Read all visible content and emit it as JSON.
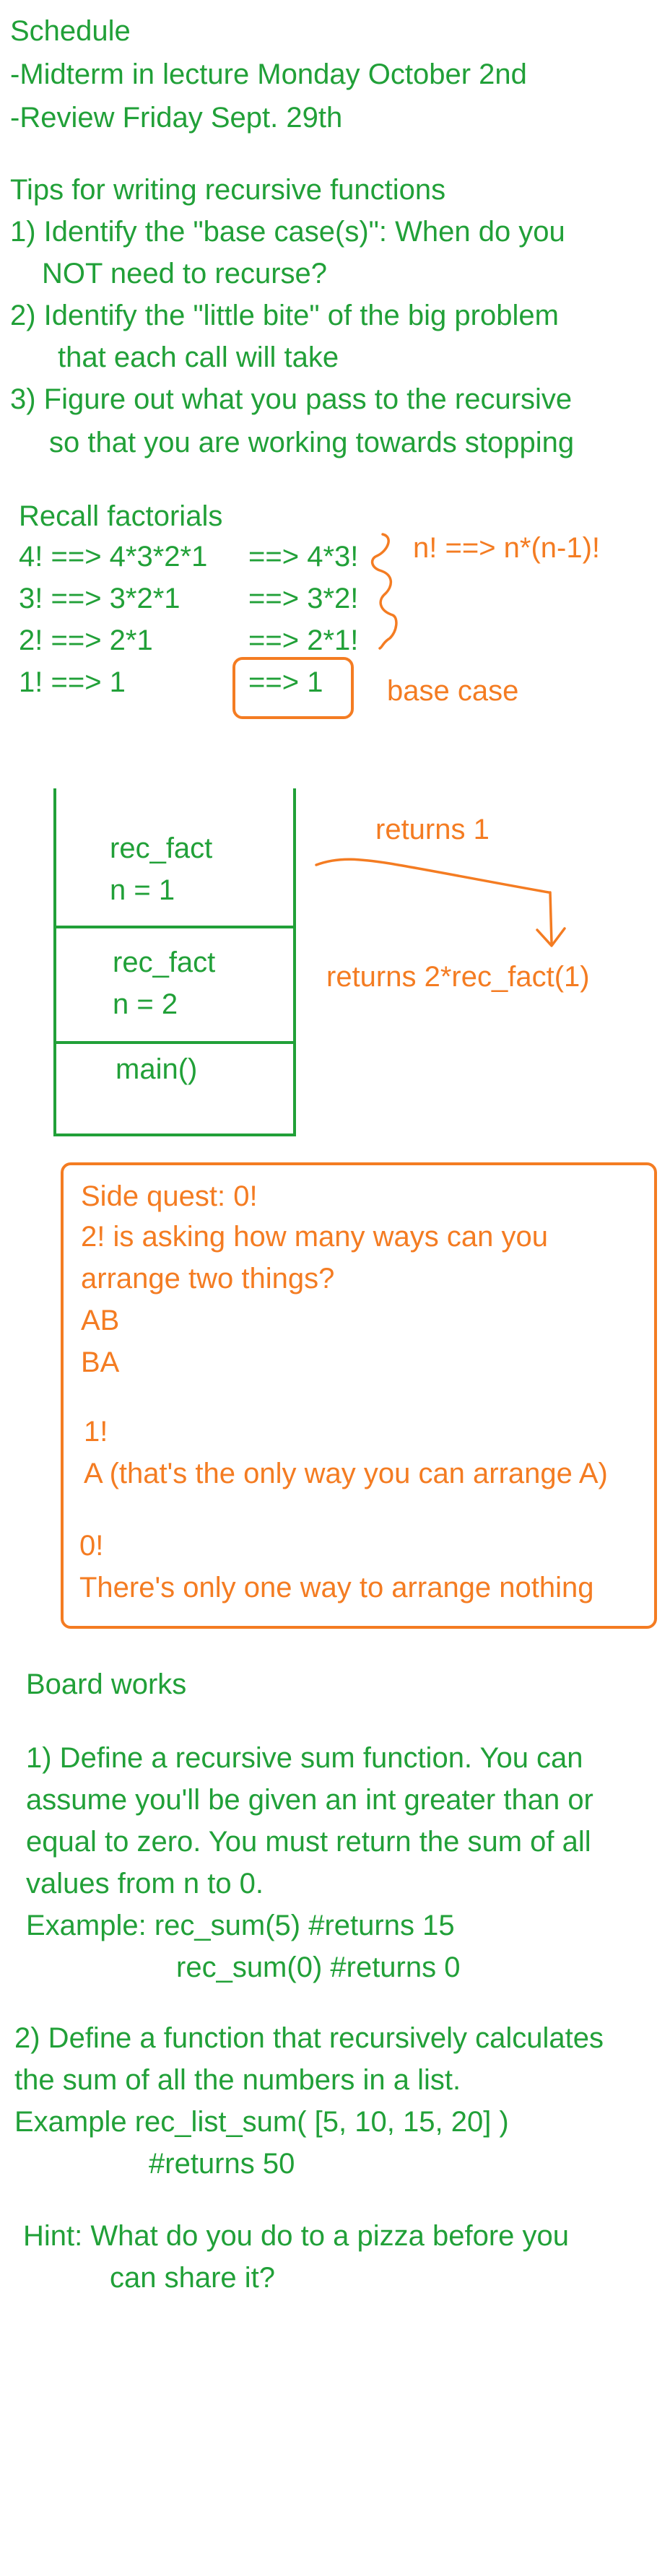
{
  "schedule": {
    "title": "Schedule",
    "line1": "-Midterm in lecture Monday October 2nd",
    "line2": "-Review Friday Sept. 29th"
  },
  "tips": {
    "title": "Tips for writing recursive functions",
    "tip1a": "1) Identify the \"base case(s)\": When do you",
    "tip1b": "NOT need to recurse?",
    "tip2a": "2) Identify the \"little bite\" of the big problem",
    "tip2b": "that each call will take",
    "tip3a": "3) Figure out what you pass to the recursive",
    "tip3b": "so that you are working towards stopping"
  },
  "factorials": {
    "title": "Recall factorials",
    "rows": [
      {
        "left": "4! ==> 4*3*2*1",
        "right": "==> 4*3!"
      },
      {
        "left": "3! ==> 3*2*1",
        "right": "==> 3*2!"
      },
      {
        "left": "2! ==> 2*1",
        "right": "==> 2*1!"
      },
      {
        "left": "1! ==> 1",
        "right": "==> 1"
      }
    ],
    "general": "n! ==> n*(n-1)!",
    "base_case": "base case"
  },
  "stack": {
    "frame1_name": "rec_fact",
    "frame1_n": "n = 1",
    "frame2_name": "rec_fact",
    "frame2_n": "n =  2",
    "frame3_name": "main()",
    "returns1": "returns 1",
    "returns2": "returns 2*rec_fact(1)"
  },
  "side_quest": {
    "title": "Side quest: 0!",
    "l1": "2! is asking how many ways can you",
    "l2": "arrange two things?",
    "l3": "AB",
    "l4": "BA",
    "l5": "1!",
    "l6": "A  (that's the only way you can arrange A)",
    "l7": "0!",
    "l8": "There's only one way to arrange nothing"
  },
  "board": {
    "title": "Board works",
    "p1a": "1) Define a recursive sum function. You can",
    "p1b": "assume you'll be given an int greater than or",
    "p1c": "equal to zero. You must return the sum of all",
    "p1d": "values from n to 0.",
    "p1e": "Example:   rec_sum(5) #returns 15",
    "p1f": "rec_sum(0) #returns 0",
    "p2a": "2) Define a function that recursively calculates",
    "p2b": "the sum of all the numbers in a list.",
    "p2c": "Example  rec_list_sum( [5, 10, 15, 20] )",
    "p2d": "#returns 50",
    "hint1": "Hint: What do you do to a pizza before you",
    "hint2": "can share it?"
  }
}
